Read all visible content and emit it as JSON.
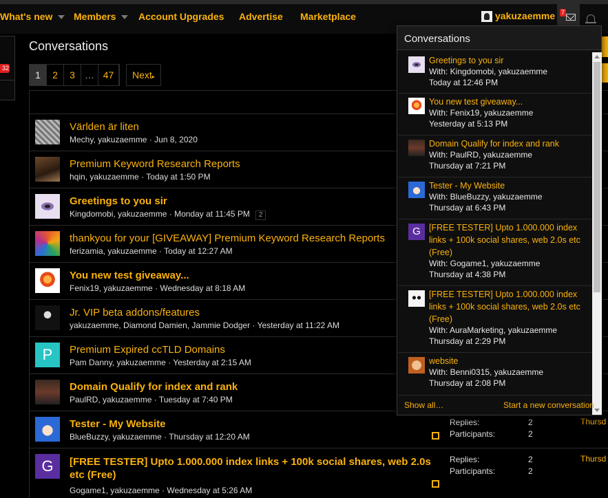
{
  "nav": {
    "items": [
      {
        "label": "What's new",
        "has_caret": true
      },
      {
        "label": "Members",
        "has_caret": true
      },
      {
        "label": "Account Upgrades",
        "has_caret": false
      },
      {
        "label": "Advertise",
        "has_caret": false
      },
      {
        "label": "Marketplace",
        "has_caret": false
      }
    ],
    "username": "yakuzaemme",
    "inbox_badge": "7",
    "accent_color": "#fbb20c"
  },
  "sidebar": {
    "badge": "32"
  },
  "page": {
    "title": "Conversations",
    "pagination": {
      "pages": [
        "1",
        "2",
        "3",
        "…",
        "47"
      ],
      "active": "1",
      "next_label": "Next"
    }
  },
  "conversations": [
    {
      "title": "Världen är liten",
      "participants": "Mechy, yakuzaemme",
      "date": "Jun 8, 2020",
      "unread": false,
      "avatar": "photo-gray"
    },
    {
      "title": "Premium Keyword Research Reports",
      "participants": "hqin, yakuzaemme",
      "date": "Today at 1:50 PM",
      "unread": false,
      "avatar": "photo-brown"
    },
    {
      "title": "Greetings to you sir",
      "participants": "Kingdomobi, yakuzaemme",
      "date": "Monday at 11:45 PM",
      "unread": true,
      "page_count": "2",
      "avatar": "eye"
    },
    {
      "title": "thankyou for your [GIVEAWAY] Premium Keyword Research Reports",
      "participants": "ferizamia, yakuzaemme",
      "date": "Today at 12:27 AM",
      "unread": false,
      "avatar": "colorful"
    },
    {
      "title": "You new test giveaway...",
      "participants": "Fenix19, yakuzaemme",
      "date": "Wednesday at 8:18 AM",
      "unread": true,
      "avatar": "phoenix"
    },
    {
      "title": "Jr. VIP beta addons/features",
      "participants": "yakuzaemme, Diamond Damien, Jammie Dodger",
      "date": "Yesterday at 11:22 AM",
      "unread": false,
      "avatar": "beard"
    },
    {
      "title": "Premium Expired ccTLD Domains",
      "participants": "Pam Danny, yakuzaemme",
      "date": "Yesterday at 2:15 AM",
      "unread": false,
      "avatar": "letter",
      "letter": "P",
      "avatar_color": "#27c4c4"
    },
    {
      "title": "Domain Qualify for index and rank",
      "participants": "PaulRD, yakuzaemme",
      "date": "Tuesday at 7:40 PM",
      "unread": true,
      "avatar": "street"
    },
    {
      "title": "Tester - My Website",
      "participants": "BlueBuzzy, yakuzaemme",
      "date": "Thursday at 12:20 AM",
      "unread": true,
      "avatar": "anime",
      "replies": "2",
      "participants_count": "2",
      "last": "Thursd"
    },
    {
      "title": "[FREE TESTER] Upto 1.000.000 index links + 100k social shares, web 2.0s etc (Free)",
      "participants": "Gogame1, yakuzaemme",
      "date": "Wednesday at 5:26 AM",
      "unread": true,
      "avatar": "letter",
      "letter": "G",
      "avatar_color": "#5a2ea0",
      "replies": "2",
      "participants_count": "2",
      "last": "Thursd"
    }
  ],
  "stats_labels": {
    "replies": "Replies:",
    "participants": "Participants:"
  },
  "panel": {
    "title": "Conversations",
    "items": [
      {
        "title": "Greetings to you sir",
        "with": "With: Kingdomobi, yakuzaemme",
        "date": "Today at 12:46 PM",
        "avatar": "eye"
      },
      {
        "title": "You new test giveaway...",
        "with": "With: Fenix19, yakuzaemme",
        "date": "Yesterday at 5:13 PM",
        "avatar": "phoenix"
      },
      {
        "title": "Domain Qualify for index and rank",
        "with": "With: PaulRD, yakuzaemme",
        "date": "Thursday at 7:21 PM",
        "avatar": "street"
      },
      {
        "title": "Tester - My Website",
        "with": "With: BlueBuzzy, yakuzaemme",
        "date": "Thursday at 6:43 PM",
        "avatar": "anime"
      },
      {
        "title": "[FREE TESTER] Upto 1.000.000 index links + 100k social shares, web 2.0s etc (Free)",
        "with": "With: Gogame1, yakuzaemme",
        "date": "Thursday at 4:38 PM",
        "avatar": "letter",
        "letter": "G",
        "avatar_color": "#5a2ea0"
      },
      {
        "title": "[FREE TESTER] Upto 1.000.000 index links + 100k social shares, web 2.0s etc (Free)",
        "with": "With: AuraMarketing, yakuzaemme",
        "date": "Thursday at 2:29 PM",
        "avatar": "panda"
      },
      {
        "title": "website",
        "with": "With: Benni0315, yakuzaemme",
        "date": "Thursday at 2:08 PM",
        "avatar": "face"
      }
    ],
    "show_all": "Show all…",
    "start_new": "Start a new conversation"
  }
}
